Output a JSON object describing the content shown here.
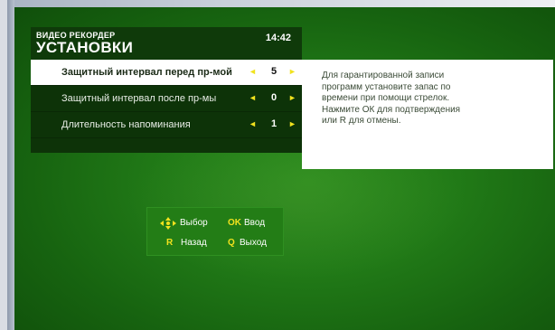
{
  "header": {
    "app_name": "ВИДЕО РЕКОРДЕР",
    "title": "УСТАНОВКИ",
    "time": "14:42"
  },
  "menu": {
    "items": [
      {
        "label": "Защитный интервал перед пр-мой",
        "value": "5",
        "selected": true
      },
      {
        "label": "Защитный интервал после пр-мы",
        "value": "0",
        "selected": false
      },
      {
        "label": "Длительность напоминания",
        "value": "1",
        "selected": false
      }
    ],
    "arrow_left": "◄",
    "arrow_right": "►"
  },
  "help": {
    "lines": [
      "Для гарантированной записи",
      "программ установите запас по",
      "времени при помощи стрелок.",
      "Нажмите ОК для подтверждения",
      "или R для отмены."
    ]
  },
  "legend": {
    "select_label": "Выбор",
    "ok_key": "OK",
    "ok_label": "Ввод",
    "back_key": "R",
    "back_label": "Назад",
    "exit_key": "Q",
    "exit_label": "Выход"
  },
  "colors": {
    "accent_yellow": "#f1e21e",
    "panel_dark": "#0d3308",
    "background_green": "#217a17",
    "selected_row": "#ffffff"
  },
  "icons": {
    "dpad": "dpad-arrows-icon"
  }
}
